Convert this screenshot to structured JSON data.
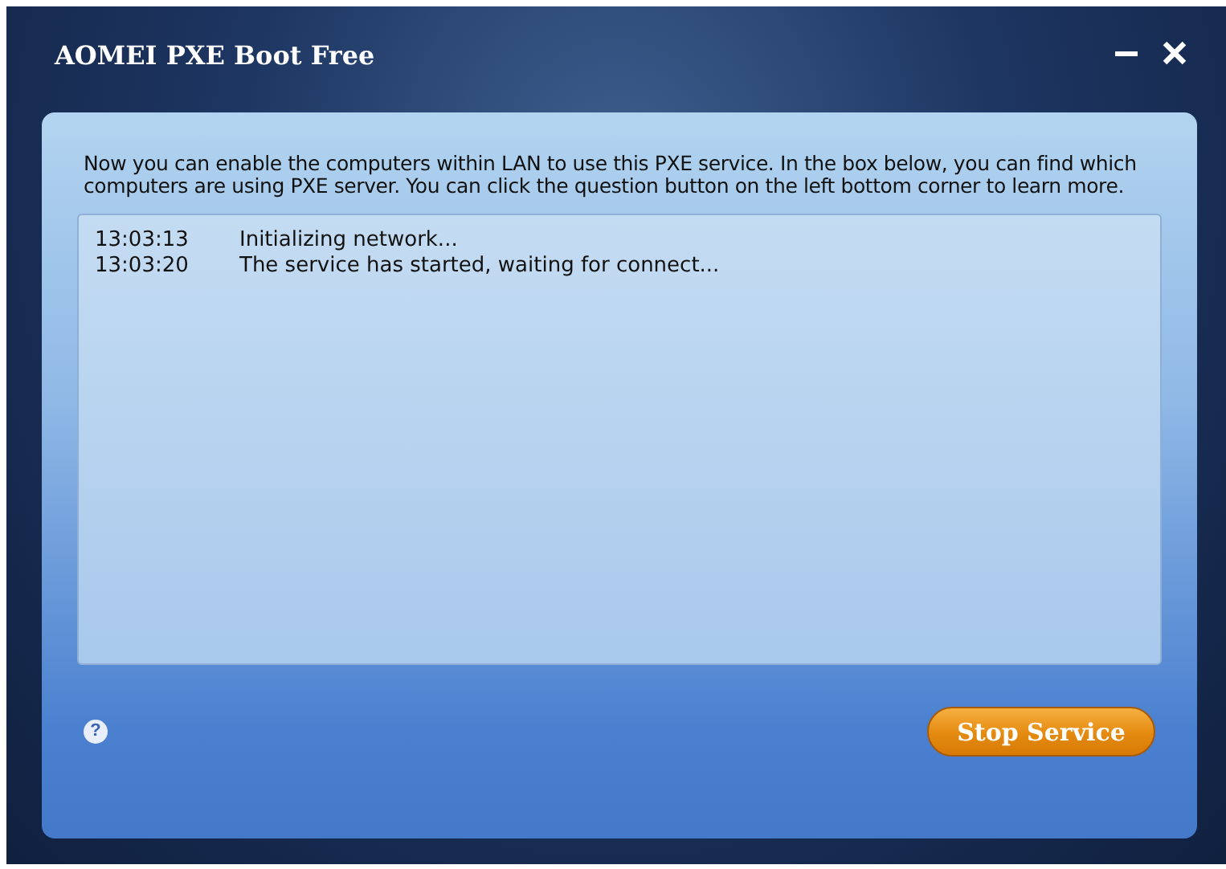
{
  "window": {
    "title": "AOMEI PXE Boot Free"
  },
  "intro": "Now you can enable the computers within LAN to use this PXE service. In the box below, you can find which computers are using PXE server. You can click the question button on the left bottom corner to learn more.",
  "log": [
    {
      "time": "13:03:13",
      "message": "Initializing network..."
    },
    {
      "time": "13:03:20",
      "message": "The service has started, waiting for connect..."
    }
  ],
  "help_button": "?",
  "stop_button": "Stop Service"
}
